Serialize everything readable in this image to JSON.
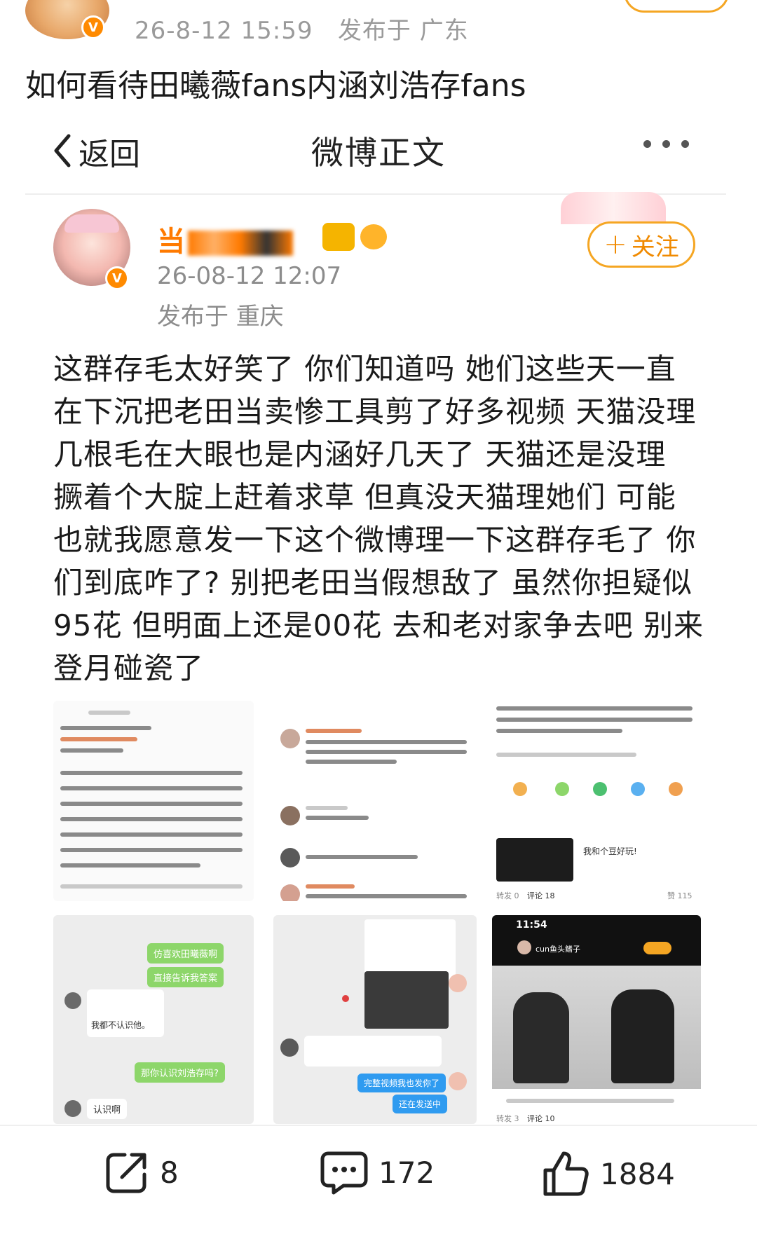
{
  "outer_post": {
    "timestamp": "26-8-12 15:59",
    "location": "发布于 广东",
    "title": "如何看待田曦薇fans内涵刘浩存fans"
  },
  "nav": {
    "back_label": "返回",
    "title": "微博正文"
  },
  "inner_post": {
    "author": {
      "name_visible": "当"
    },
    "timestamp": "26-08-12 12:07",
    "location": "发布于 重庆",
    "follow_label": "关注",
    "follow_plus": "+",
    "body": "这群存毛太好笑了 你们知道吗 她们这些天一直在下沉把老田当卖惨工具剪了好多视频 天猫没理 几根毛在大眼也是内涵好几天了 天猫还是没理 撅着个大腚上赶着求草 但真没天猫理她们 可能也就我愿意发一下这个微博理一下这群存毛了 你们到底咋了? 别把老田当假想敌了 虽然你担疑似95花 但明面上还是00花 去和老对家争去吧 别来登月碰瓷了"
  },
  "images": {
    "img3": {
      "tab_forward": "转发 0",
      "tab_comment": "评论 18",
      "like_count": "赞 115",
      "chat": "我和个豆好玩!"
    },
    "img4": {
      "bubble1": "仿喜欢田曦薇啊",
      "bubble2": "直接告诉我答案",
      "reply": "我都不认识他。",
      "bubble3": "那你认识刘浩存吗?",
      "reply2": "认识啊"
    },
    "img5": {
      "bubble1": "完整视频我也发你了",
      "bubble2": "还在发送中"
    },
    "img6": {
      "time": "11:54",
      "username": "cun鱼头鳍子",
      "tab_forward": "转发 3",
      "tab_comment": "评论 10"
    }
  },
  "actions": {
    "repost_count": "8",
    "comment_count": "172",
    "like_count": "1884"
  },
  "colors": {
    "accent_orange": "#f5a623",
    "follow_text": "#f08a00",
    "verified_badge": "#ff8a00"
  }
}
